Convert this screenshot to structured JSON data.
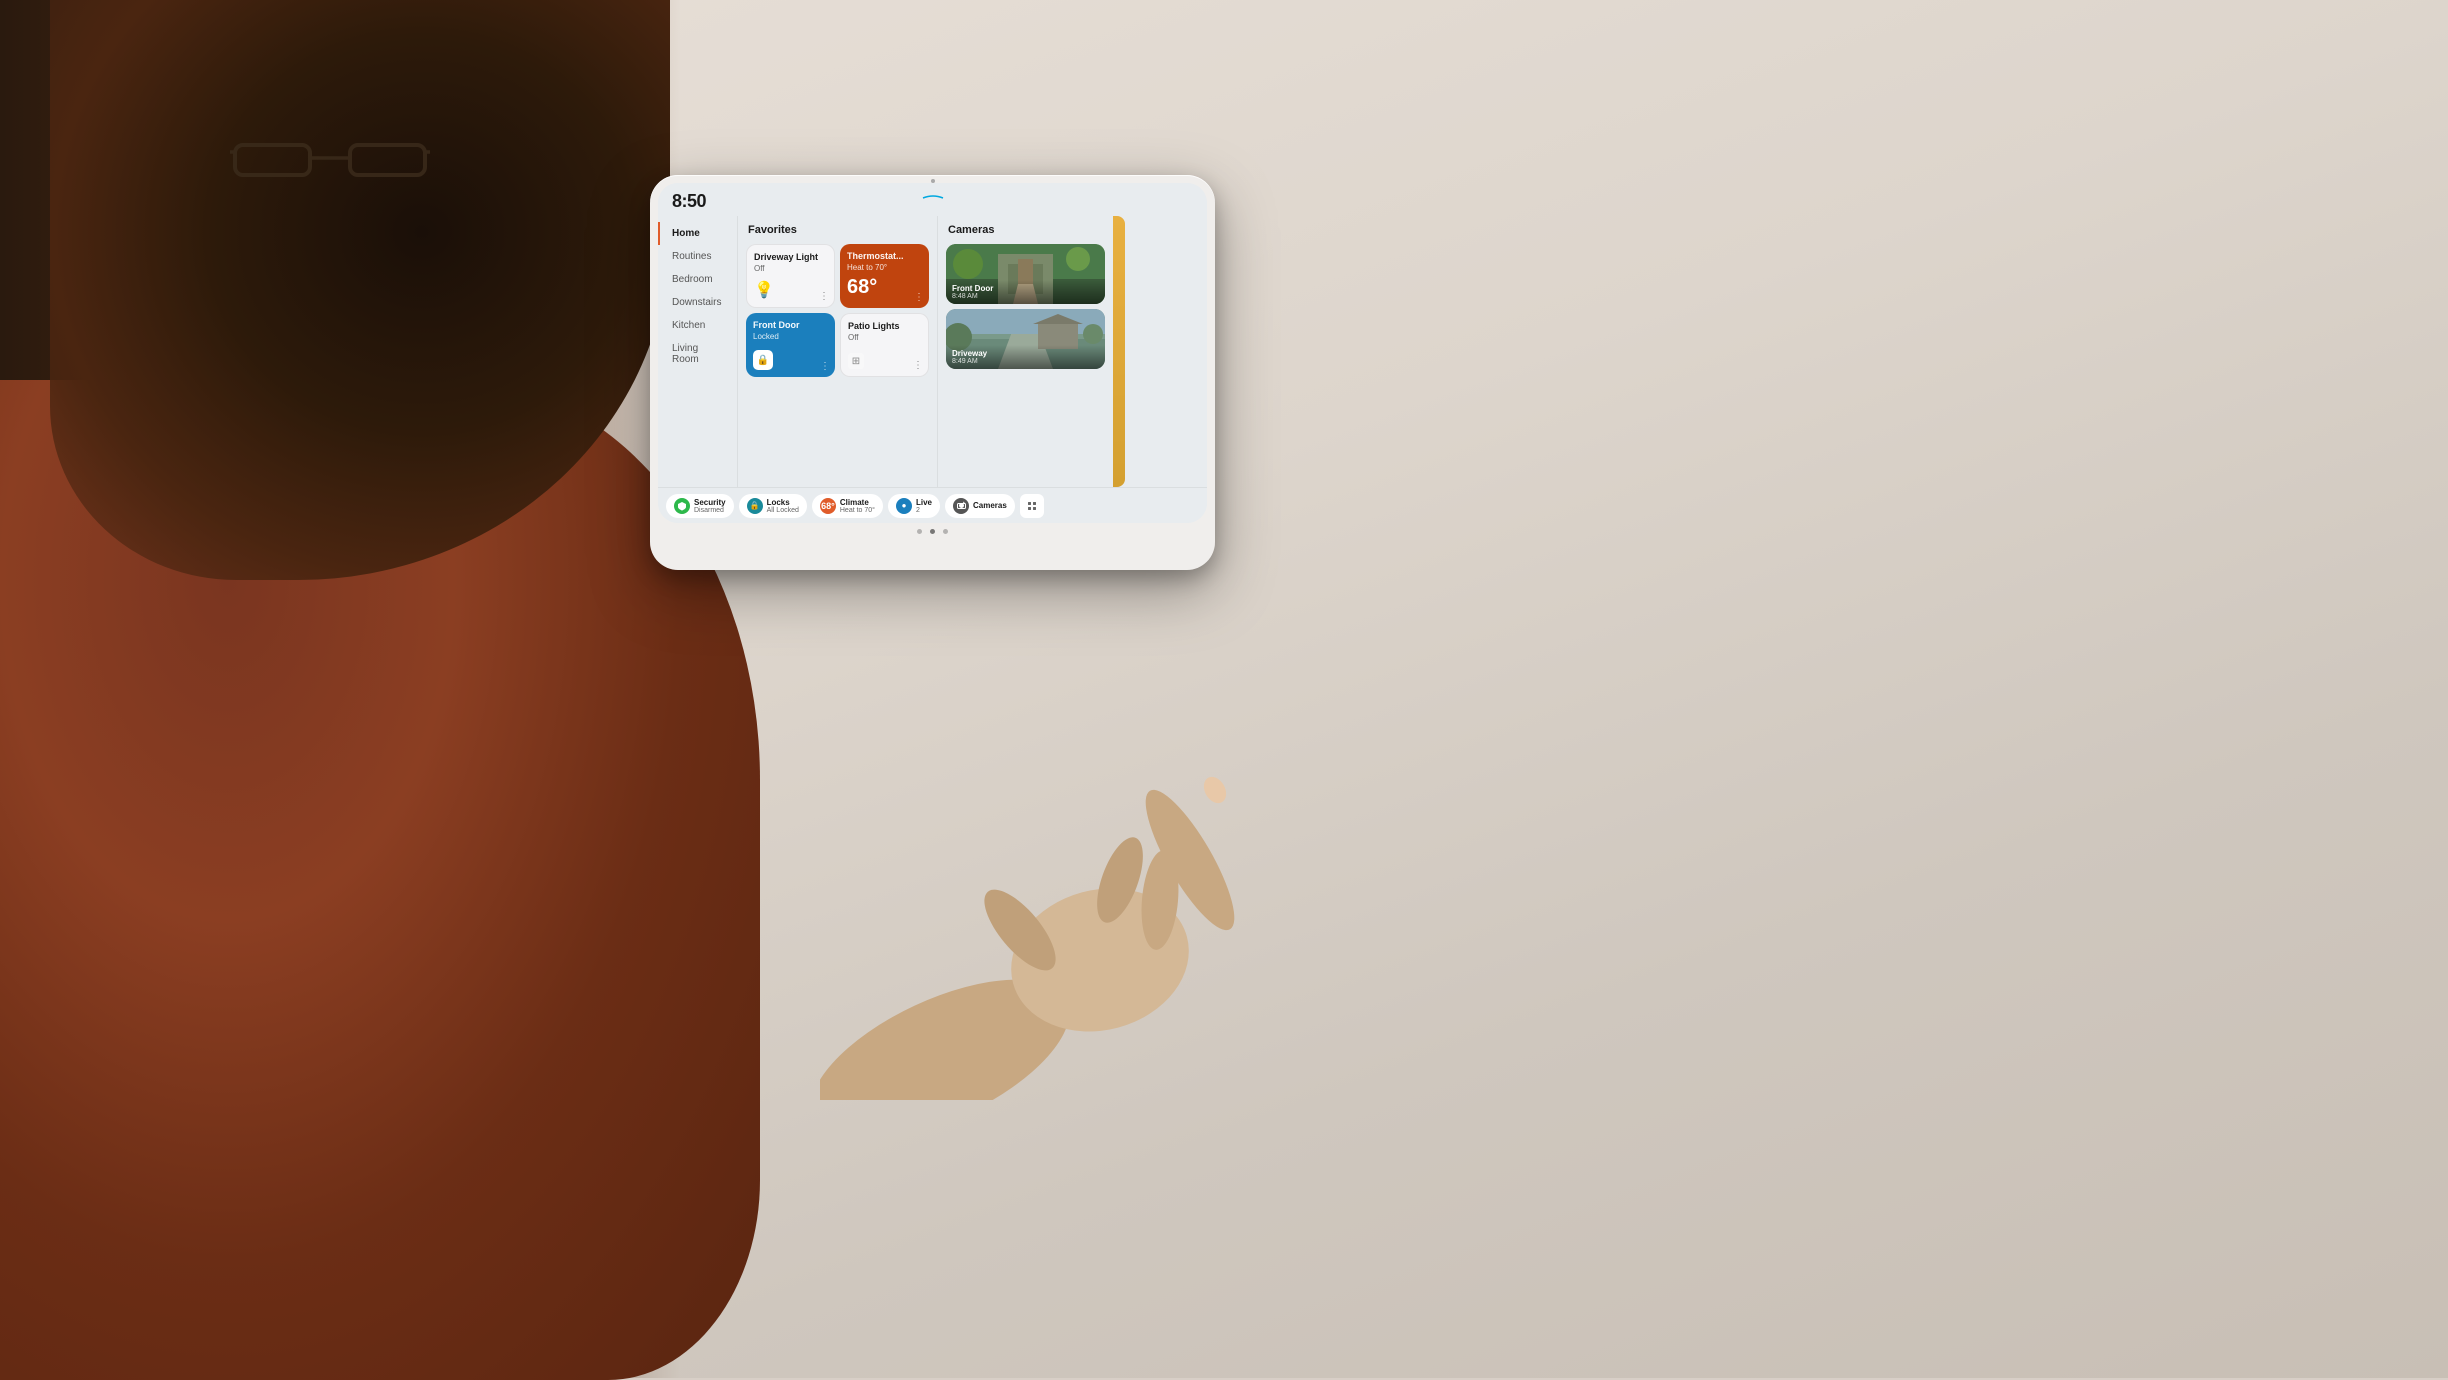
{
  "background": {
    "wall_color": "#d8cfc7"
  },
  "device": {
    "time": "8:50",
    "dots": [
      "",
      "",
      ""
    ]
  },
  "sidebar": {
    "items": [
      {
        "label": "Home",
        "active": true
      },
      {
        "label": "Routines",
        "active": false
      },
      {
        "label": "Bedroom",
        "active": false
      },
      {
        "label": "Downstairs",
        "active": false
      },
      {
        "label": "Kitchen",
        "active": false
      },
      {
        "label": "Living Room",
        "active": false
      }
    ]
  },
  "favorites": {
    "title": "Favorites",
    "tiles": [
      {
        "name": "Driveway Light",
        "status": "Off",
        "type": "light",
        "icon": "💡"
      },
      {
        "name": "Thermostat",
        "status": "Heat to 70°",
        "type": "thermostat",
        "value": "68°"
      },
      {
        "name": "Front Door",
        "status": "Locked",
        "type": "frontdoor",
        "icon": "🔒"
      },
      {
        "name": "Patio Lights",
        "status": "Off",
        "type": "patio",
        "icon": "□"
      }
    ]
  },
  "cameras": {
    "title": "Cameras",
    "items": [
      {
        "name": "Front Door",
        "time": "8:48 AM"
      },
      {
        "name": "Driveway",
        "time": "8:49 AM"
      }
    ]
  },
  "status_bar": {
    "items": [
      {
        "label": "Security",
        "sub": "Disarmed",
        "icon_type": "green",
        "icon": "🛡"
      },
      {
        "label": "Locks",
        "sub": "All Locked",
        "icon_type": "teal",
        "icon": "🔒"
      },
      {
        "label": "Climate",
        "sub": "Heat to 70°",
        "icon_type": "orange",
        "value": "68°"
      },
      {
        "label": "Live",
        "sub": "2",
        "icon_type": "blue",
        "icon": "●"
      },
      {
        "label": "Cameras",
        "icon_type": "dark"
      }
    ]
  }
}
